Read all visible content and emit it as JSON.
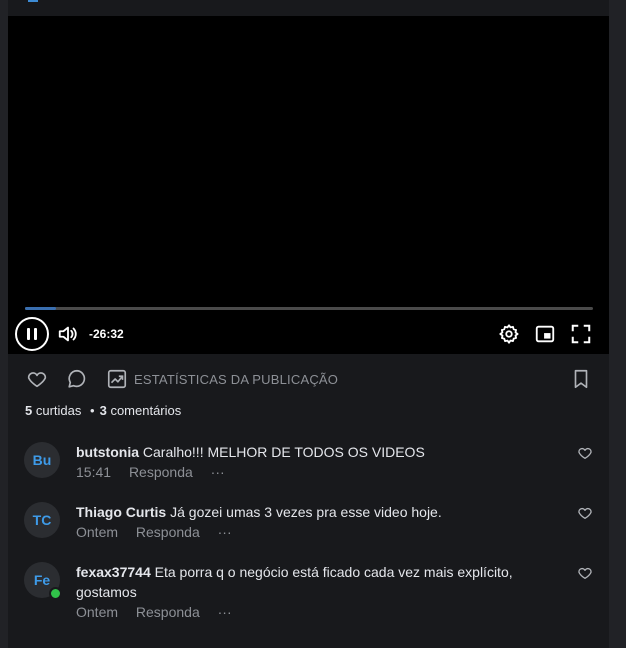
{
  "video": {
    "time_remaining": "-26:32",
    "progress": 0.055
  },
  "actions": {
    "stats_label": "ESTATÍSTICAS DA PUBLICAÇÃO"
  },
  "counts": {
    "likes_number": "5",
    "likes_word": "curtidas",
    "separator": "•",
    "comments_number": "3",
    "comments_word": "comentários"
  },
  "comments": [
    {
      "avatar": "Bu",
      "user": "butstonia",
      "text": "Caralho!!! MELHOR DE TODOS OS VIDEOS",
      "time": "15:41",
      "reply": "Responda",
      "more": "···",
      "online": false
    },
    {
      "avatar": "TC",
      "user": "Thiago Curtis",
      "text": "Já gozei umas 3 vezes pra esse video hoje.",
      "time": "Ontem",
      "reply": "Responda",
      "more": "···",
      "online": false
    },
    {
      "avatar": "Fe",
      "user": "fexax37744",
      "text": "Eta porra q o negócio está ficado cada vez mais explícito, gostamos",
      "time": "Ontem",
      "reply": "Responda",
      "more": "···",
      "online": true
    }
  ],
  "colors": {
    "accent": "#3e9be9",
    "online": "#31c24a"
  }
}
